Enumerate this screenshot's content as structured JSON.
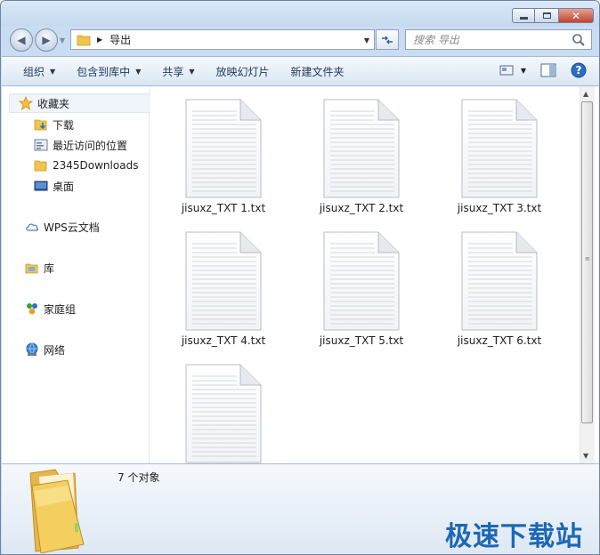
{
  "window": {
    "controls": {
      "minimize": "▭",
      "maximize": "□",
      "close": "✕"
    }
  },
  "address": {
    "path": "导出",
    "search_placeholder": "搜索 导出"
  },
  "toolbar": {
    "organize": "组织",
    "include_in_library": "包含到库中",
    "share": "共享",
    "slideshow": "放映幻灯片",
    "new_folder": "新建文件夹"
  },
  "sidebar": {
    "favorites": "收藏夹",
    "downloads": "下载",
    "recent": "最近访问的位置",
    "downloads2345": "2345Downloads",
    "desktop": "桌面",
    "wps": "WPS云文档",
    "library": "库",
    "homegroup": "家庭组",
    "network": "网络"
  },
  "files": [
    {
      "name": "jisuxz_TXT 1.txt"
    },
    {
      "name": "jisuxz_TXT 2.txt"
    },
    {
      "name": "jisuxz_TXT 3.txt"
    },
    {
      "name": "jisuxz_TXT 4.txt"
    },
    {
      "name": "jisuxz_TXT 5.txt"
    },
    {
      "name": "jisuxz_TXT 6.txt"
    },
    {
      "name": ""
    }
  ],
  "status": {
    "count_text": "7 个对象"
  },
  "watermark": "极速下载站",
  "colors": {
    "accent": "#1d68b5",
    "folder": "#f2c44c",
    "close_red": "#c2432c"
  }
}
